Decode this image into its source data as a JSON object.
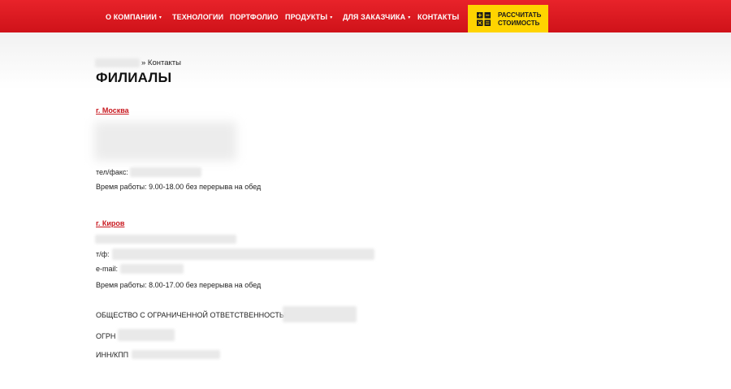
{
  "nav": {
    "items": [
      {
        "label": "О КОМПАНИИ",
        "chevron": "▾"
      },
      {
        "label": "ТЕХНОЛОГИИ",
        "chevron": ""
      },
      {
        "label": "ПОРТФОЛИО",
        "chevron": ""
      },
      {
        "label": "ПРОДУКТЫ",
        "chevron": "▾"
      },
      {
        "label": "ДЛЯ ЗАКАЗЧИКА",
        "chevron": "▾"
      },
      {
        "label": "КОНТАКТЫ",
        "chevron": ""
      }
    ],
    "cta": {
      "label": "РАССЧИТАТЬ\nСТОИМОСТЬ",
      "icon": "calculator-icon"
    }
  },
  "breadcrumb": {
    "current": "» Контакты"
  },
  "page_title": "ФИЛИАЛЫ",
  "branches": [
    {
      "city": "г. Москва",
      "phone_label": "тел/факс:",
      "hours": "Время работы: 9.00-18.00 без перерыва на обед"
    },
    {
      "city": "г. Киров",
      "phone_label": "т/ф:",
      "email_label": "e-mail:",
      "hours": "Время работы: 8.00-17.00 без перерыва на обед"
    }
  ],
  "company": {
    "name_label": "ОБЩЕСТВО С ОГРАНИЧЕННОЙ ОТВЕТСТВЕННОСТЬЮ",
    "ogrn_label": "ОГРН",
    "inn_label": "ИНН/КПП"
  },
  "colors": {
    "nav_red": "#d9151c",
    "cta_yellow": "#ffd400",
    "link_red": "#c8161d"
  }
}
